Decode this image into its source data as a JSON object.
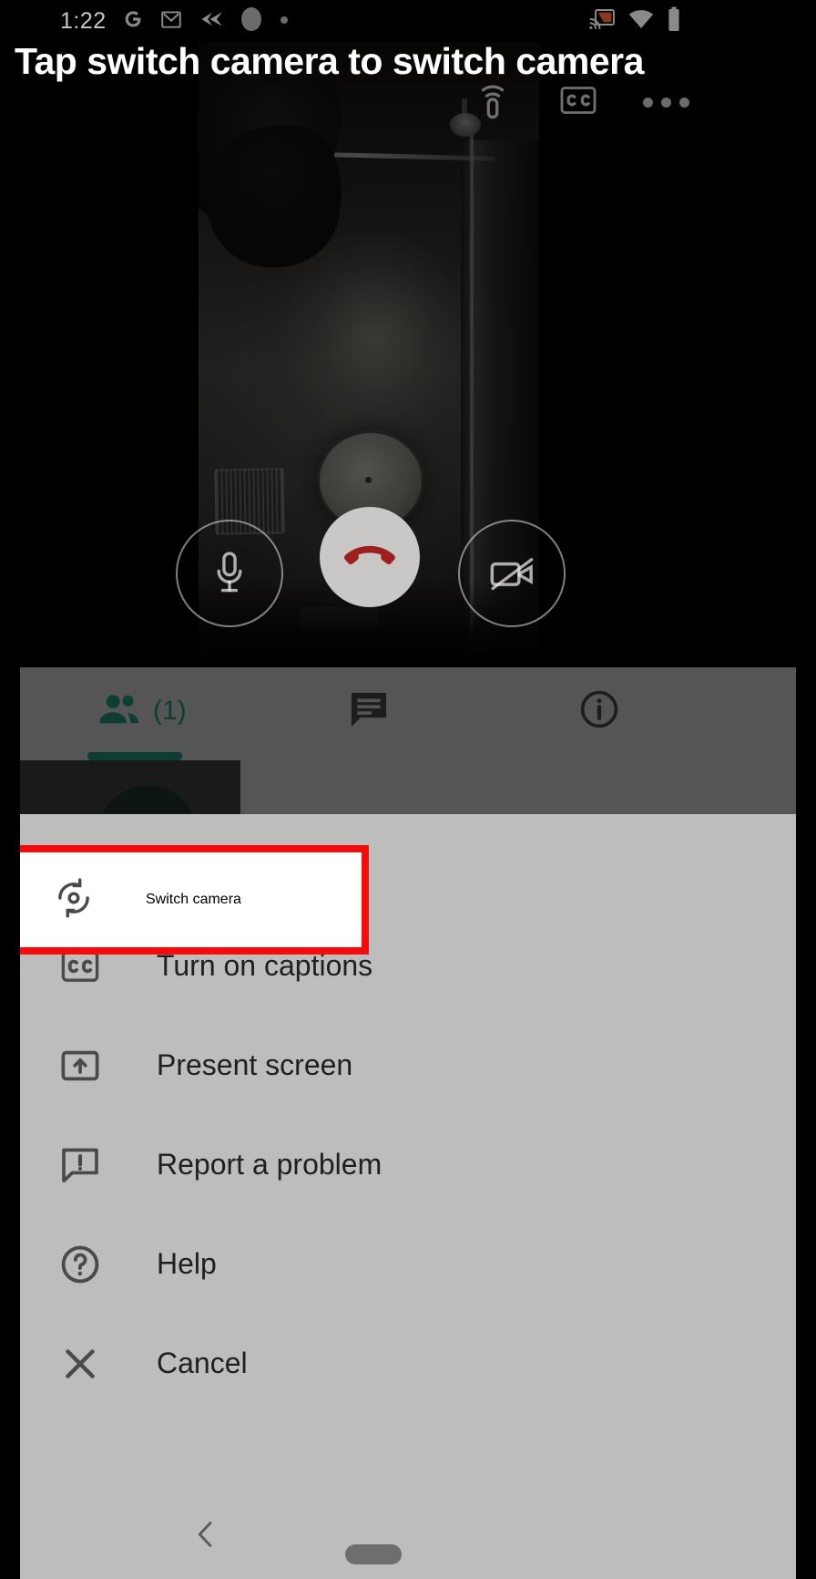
{
  "status_bar": {
    "time": "1:22",
    "left_icons": [
      "google-icon",
      "gmail-icon",
      "send-arrow-icon",
      "circle-icon",
      "dot-icon"
    ],
    "right_icons": [
      "cast-icon",
      "wifi-icon",
      "battery-icon"
    ],
    "cast_accent_color": "#8a3a1c"
  },
  "banner": {
    "instruction": "Tap switch camera to switch camera"
  },
  "app_bar": {
    "cast_icon": "cast-icon",
    "captions_icon": "closed-captions-icon",
    "more_icon": "more-options-icon"
  },
  "call_controls": {
    "mic": {
      "name": "microphone-button",
      "icon": "microphone-icon"
    },
    "end_call": {
      "name": "end-call-button",
      "icon": "phone-hangup-icon",
      "color": "#9c2020"
    },
    "video": {
      "name": "camera-button",
      "icon": "video-camera-off-icon"
    }
  },
  "panel": {
    "tabs": [
      {
        "name": "tab-people",
        "icon": "people-icon",
        "count_label": "(1)",
        "selected": true
      },
      {
        "name": "tab-chat",
        "icon": "chat-bubble-icon",
        "count_label": "",
        "selected": false
      },
      {
        "name": "tab-info",
        "icon": "info-circle-icon",
        "count_label": "",
        "selected": false
      }
    ],
    "accent_color": "#0d3d33",
    "background_color": "#555555"
  },
  "sheet": {
    "background_color": "#bdbdbd",
    "highlight_color": "#f60a0a",
    "items": [
      {
        "label": "Switch camera",
        "icon": "switch-camera-icon",
        "highlighted": true
      },
      {
        "label": "Turn on captions",
        "icon": "closed-captions-icon",
        "highlighted": false
      },
      {
        "label": "Present screen",
        "icon": "present-screen-icon",
        "highlighted": false
      },
      {
        "label": "Report a problem",
        "icon": "report-problem-icon",
        "highlighted": false
      },
      {
        "label": "Help",
        "icon": "help-circle-icon",
        "highlighted": false
      },
      {
        "label": "Cancel",
        "icon": "close-x-icon",
        "highlighted": false
      }
    ]
  },
  "nav_bar": {
    "back_icon": "back-chevron-icon",
    "home_indicator": "home-pill-indicator"
  }
}
